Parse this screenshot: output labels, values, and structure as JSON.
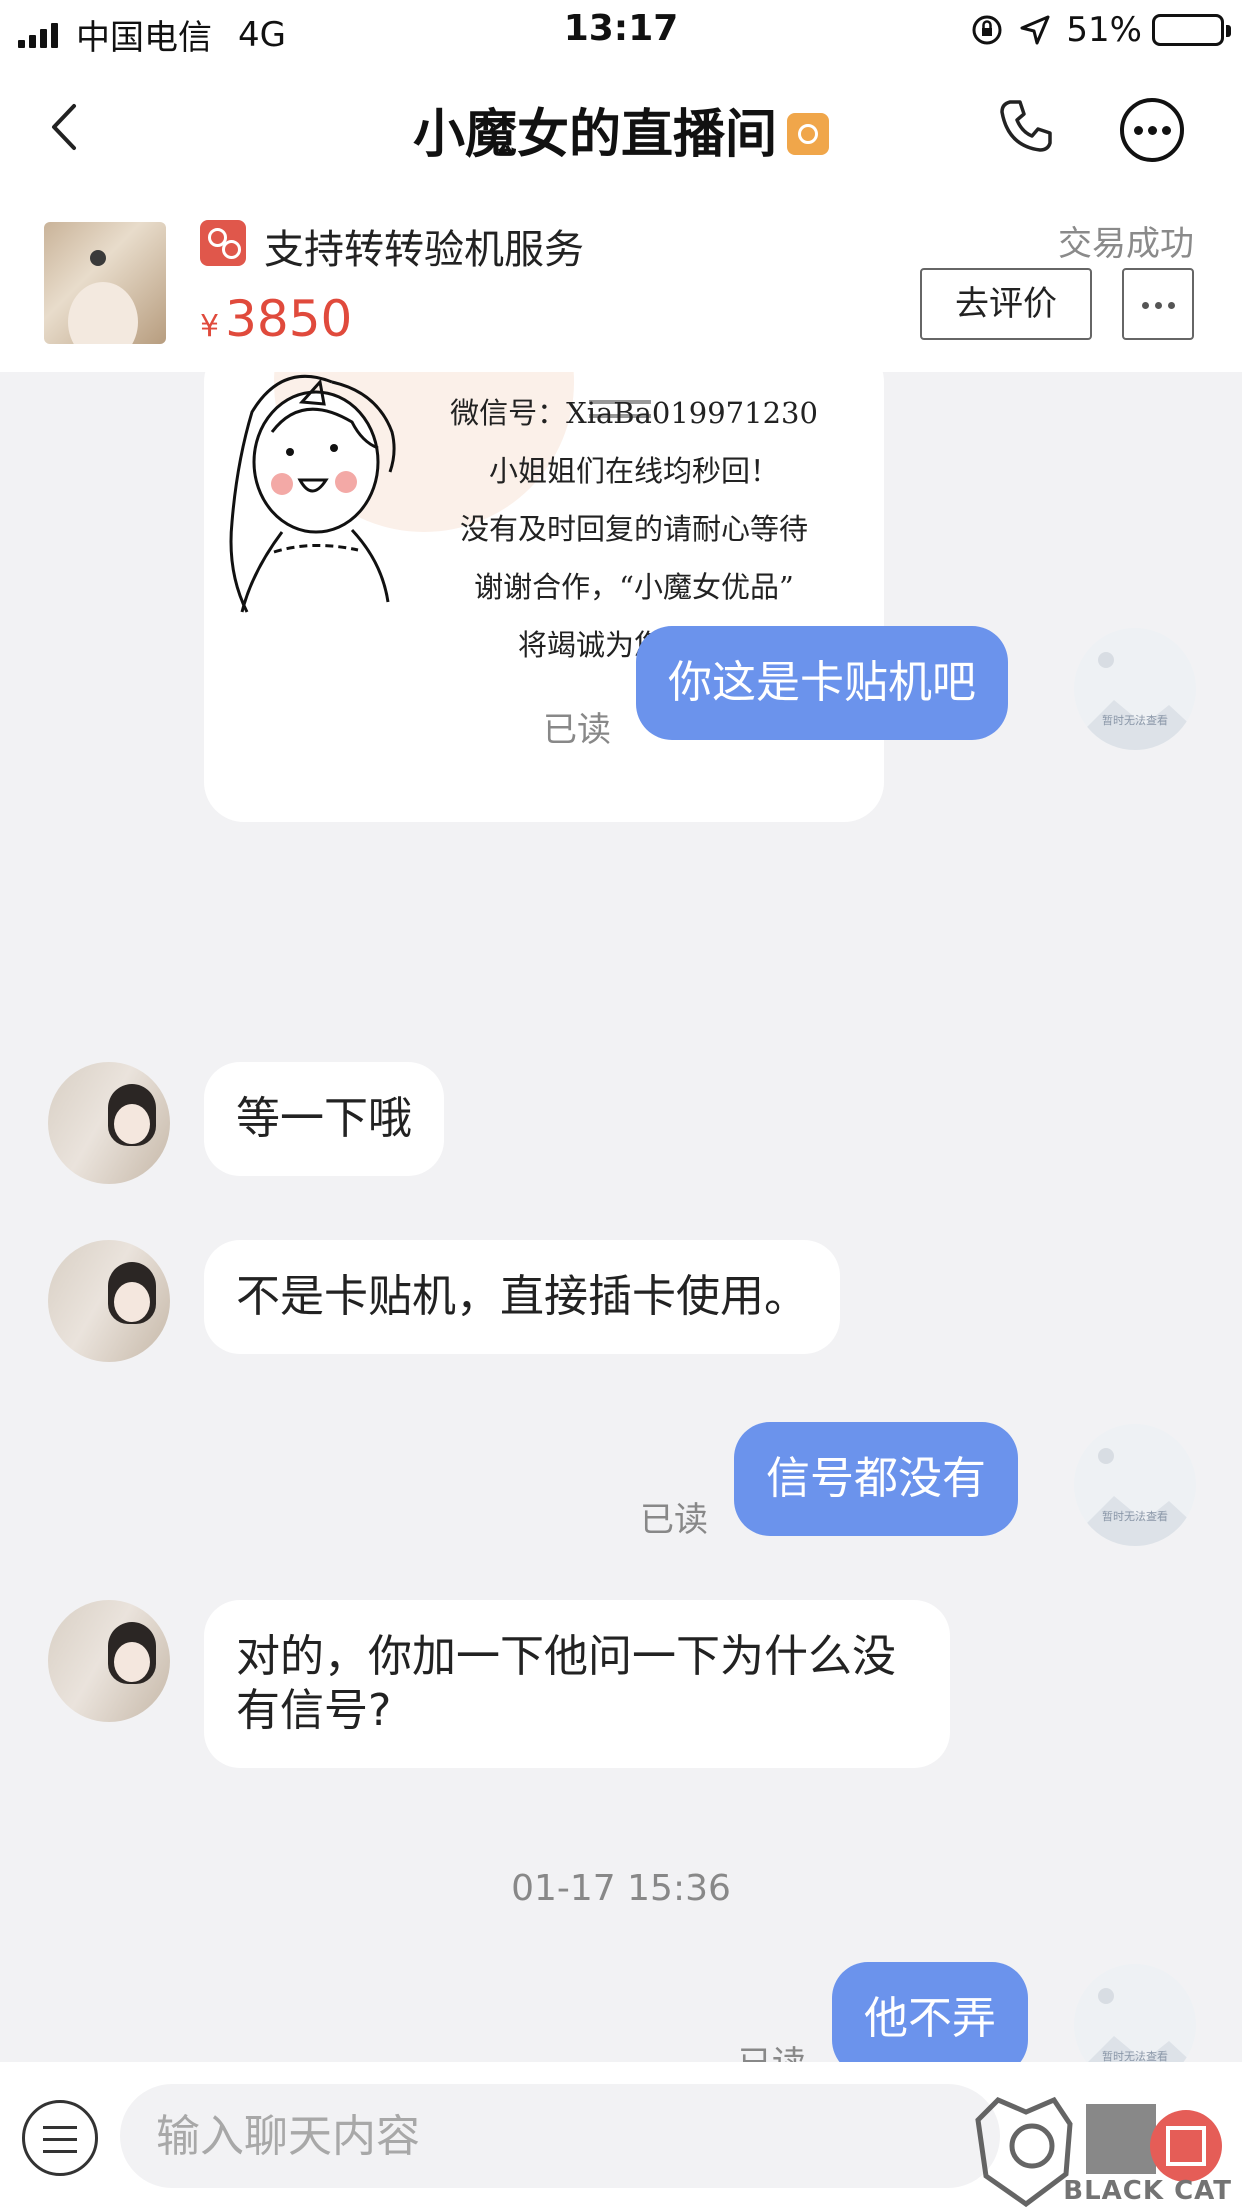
{
  "status_bar": {
    "carrier": "中国电信",
    "network": "4G",
    "time": "13:17",
    "battery_percent": "51%",
    "battery_level": 0.51
  },
  "nav": {
    "title": "小魔女的直播间",
    "back_icon": "chevron-left-icon",
    "phone_icon": "phone-icon",
    "more_icon": "more-circle-icon"
  },
  "product": {
    "service_text": "支持转转验机服务",
    "currency": "¥",
    "price": "3850",
    "status": "交易成功",
    "review_button": "去评价",
    "accent_color": "#e04a3c"
  },
  "card": {
    "lines": [
      "微信号：XiaBa019971230",
      "小姐姐们在线均秒回！",
      "没有及时回复的请耐心等待",
      "谢谢合作，“小魔女优品”",
      "将竭诚为您服务！"
    ]
  },
  "messages": [
    {
      "side": "out",
      "text": "你这是卡贴机吧",
      "read": "已读"
    },
    {
      "side": "in",
      "text": "等一下哦"
    },
    {
      "side": "in",
      "text": "不是卡贴机，直接插卡使用。"
    },
    {
      "side": "out",
      "text": "信号都没有",
      "read": "已读"
    },
    {
      "side": "in",
      "text": "对的，你加一下他问一下为什么没有信号?"
    },
    {
      "side": "out",
      "text": "他不弄",
      "read": "已读"
    }
  ],
  "timestamp": "01-17 15:36",
  "placeholder_avatar_caption": "暂时无法查看",
  "input": {
    "placeholder": "输入聊天内容",
    "menu_icon": "menu-icon"
  },
  "watermark": {
    "text": "BLACK CAT",
    "logo_text": "黑猫"
  },
  "colors": {
    "outgoing_bubble": "#6b93ec",
    "incoming_bubble": "#ffffff",
    "background": "#f2f2f4"
  }
}
